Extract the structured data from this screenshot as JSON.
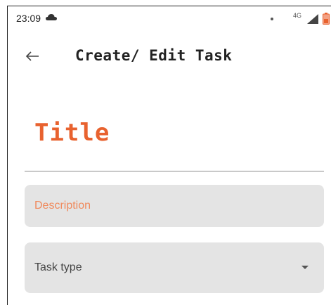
{
  "status_bar": {
    "time": "23:09",
    "network_label": "4G",
    "icons": [
      "cloud-icon",
      "dot-icon",
      "signal-icon",
      "battery-icon"
    ]
  },
  "app_bar": {
    "back_icon": "arrow-left-icon",
    "title": "Create/ Edit Task"
  },
  "form": {
    "title_value": "Title",
    "description_placeholder": "Description",
    "task_type_label": "Task type",
    "task_type_icon": "chevron-down-icon"
  },
  "colors": {
    "accent": "#e8622f",
    "placeholder": "#f08a5d",
    "field_bg": "#e4e4e4",
    "text": "#222222"
  }
}
